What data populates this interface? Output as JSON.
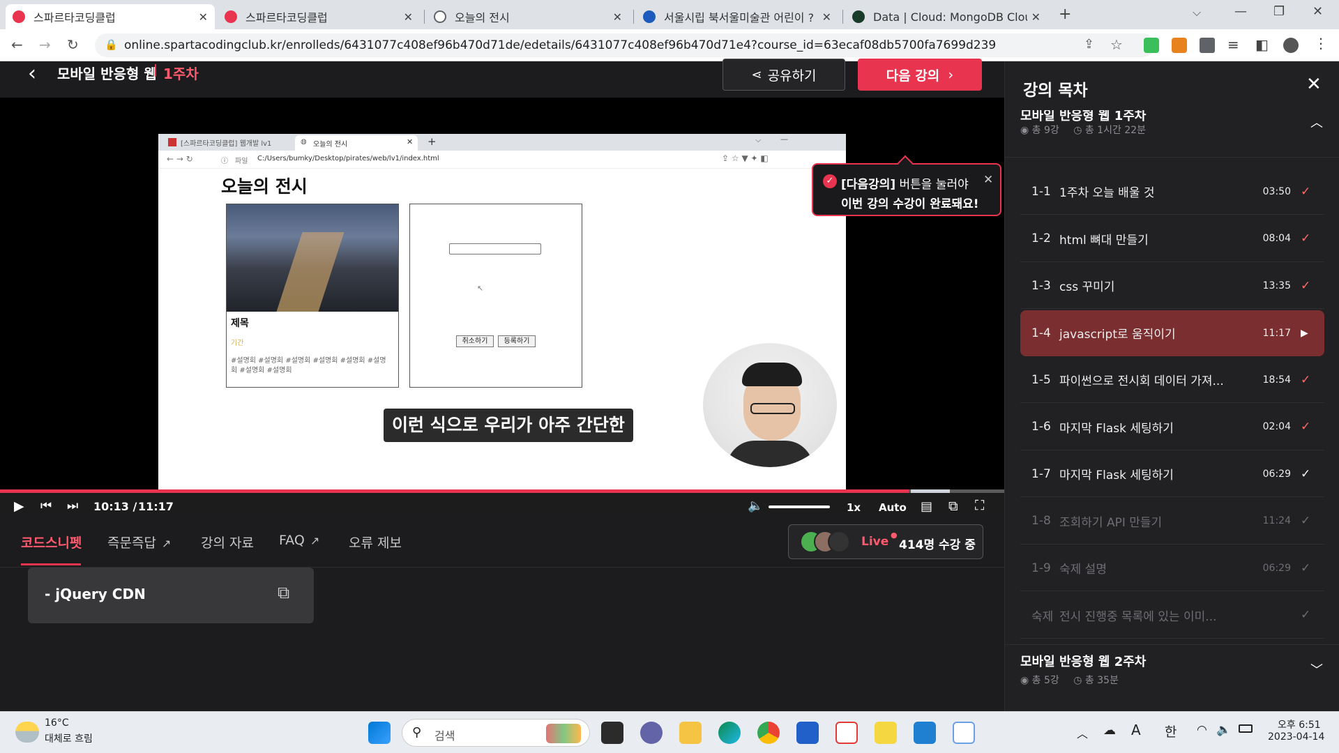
{
  "browser": {
    "tabs": [
      {
        "title": "스파르타코딩클럽",
        "color": "#e8344e"
      },
      {
        "title": "스파르타코딩클럽",
        "color": "#e8344e"
      },
      {
        "title": "오늘의 전시",
        "color": "#5f6368"
      },
      {
        "title": "서울시립 북서울미술관 어린이 ? ",
        "color": "#1c5bbd"
      },
      {
        "title": "Data | Cloud: MongoDB Cloud",
        "color": "#1a3a2a"
      }
    ],
    "url": "online.spartacodingclub.kr/enrolleds/6431077c408ef96b470d71de/edetails/6431077c408ef96b470d71e4?course_id=63ecaf08db5700fa7699d239",
    "new_tab": "+"
  },
  "player": {
    "course_title": "모바일 반응형 웹",
    "week": "1주차",
    "share_label": "공유하기",
    "next_label": "다음 강의",
    "tooltip_bold": "[다음강의]",
    "tooltip_line1": " 버튼을 눌러야",
    "tooltip_line2": "이번 강의 수강이 완료돼요!",
    "subtitle": "이런 식으로 우리가 아주 간단한",
    "time_current": "10:13 /",
    "time_total": "11:17",
    "speed": "1x",
    "quality": "Auto",
    "progress_fraction": 0.905
  },
  "inner_browser": {
    "tab1": "[스파르타코딩클럽] 웹개발 lv1",
    "tab2": "오늘의 전시",
    "file_label": "파일",
    "url": "C:/Users/bumky/Desktop/pirates/web/lv1/index.html",
    "page_title": "오늘의 전시",
    "card_title": "제목",
    "card_period": "기간",
    "card_desc": "#설명회 #설명회 #설명회 #설명회 #설명회 #설명회 #설명회 #설명회",
    "cancel_label": "취소하기",
    "register_label": "등록하기"
  },
  "tabs_below": {
    "items": [
      "코드스니펫",
      "즉문즉답",
      "강의 자료",
      "FAQ",
      "오류 제보"
    ],
    "live_label": "Live",
    "live_count": "414명 수강 중"
  },
  "snippet": {
    "label": "- jQuery CDN"
  },
  "sidebar": {
    "title": "강의 목차",
    "week1": {
      "title": "모바일 반응형 웹 1주차",
      "count": "총 9강",
      "total": "총 1시간 22분"
    },
    "lectures": [
      {
        "num": "1-1",
        "name": "1주차 오늘 배울 것",
        "dur": "03:50",
        "state": "done"
      },
      {
        "num": "1-2",
        "name": "html 뼈대 만들기",
        "dur": "08:04",
        "state": "done"
      },
      {
        "num": "1-3",
        "name": "css 꾸미기",
        "dur": "13:35",
        "state": "done"
      },
      {
        "num": "1-4",
        "name": "javascript로 움직이기",
        "dur": "11:17",
        "state": "active"
      },
      {
        "num": "1-5",
        "name": "파이썬으로 전시회 데이터 가져...",
        "dur": "18:54",
        "state": "done"
      },
      {
        "num": "1-6",
        "name": "마지막 Flask 세팅하기",
        "dur": "02:04",
        "state": "done"
      },
      {
        "num": "1-7",
        "name": "마지막 Flask 세팅하기",
        "dur": "06:29",
        "state": "white"
      },
      {
        "num": "1-8",
        "name": "조회하기 API 만들기",
        "dur": "11:24",
        "state": "dim"
      },
      {
        "num": "1-9",
        "name": "숙제 설명",
        "dur": "06:29",
        "state": "dim"
      },
      {
        "num": "숙제",
        "name": "전시 진행중 목록에 있는 이미...",
        "dur": "",
        "state": "dim"
      }
    ],
    "week2": {
      "title": "모바일 반응형 웹 2주차",
      "count": "총 5강",
      "total": "총 35분"
    }
  },
  "taskbar": {
    "temp": "16°C",
    "weather": "대체로 흐림",
    "search": "검색",
    "ime_a": "A",
    "ime_han": "한",
    "time": "오후 6:51",
    "date": "2023-04-14"
  }
}
